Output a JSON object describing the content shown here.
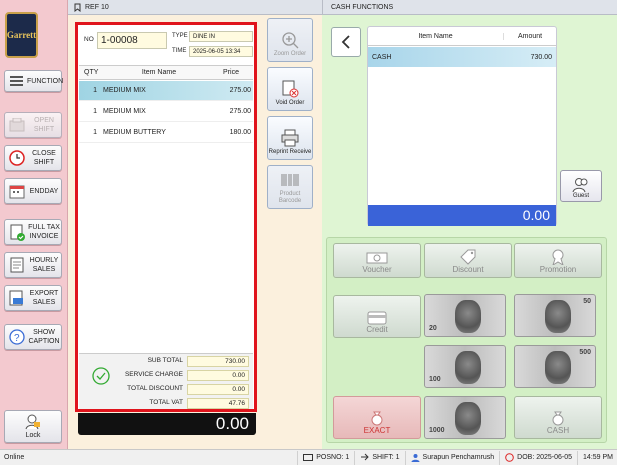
{
  "ref_bar": {
    "label": "REF 10"
  },
  "cash_bar": {
    "label": "CASH FUNCTIONS"
  },
  "logo": {
    "text": "Garrett"
  },
  "sidebar": {
    "function": "FUNCTION",
    "open_shift": "OPEN SHIFT",
    "close_shift": "CLOSE SHIFT",
    "endday": "ENDDAY",
    "full_tax_invoice": "FULL TAX INVOICE",
    "hourly_sales": "HOURLY SALES",
    "export_sales": "EXPORT SALES",
    "show_caption": "SHOW CAPTION",
    "lock": "Lock"
  },
  "order": {
    "no_label": "NO",
    "no_value": "1-00008",
    "type_label": "TYPE",
    "type_value": "DINE IN",
    "time_label": "TIME",
    "time_value": "2025-06-05 13:34",
    "columns": {
      "qty": "QTY",
      "item": "Item Name",
      "price": "Price"
    },
    "items": [
      {
        "qty": "1",
        "name": "MEDIUM MIX",
        "price": "275.00"
      },
      {
        "qty": "1",
        "name": "MEDIUM MIX",
        "price": "275.00"
      },
      {
        "qty": "1",
        "name": "MEDIUM BUTTERY",
        "price": "180.00"
      }
    ],
    "totals": {
      "sub_total_label": "SUB TOTAL",
      "sub_total": "730.00",
      "service_charge_label": "SERVICE CHARGE",
      "service_charge": "0.00",
      "total_discount_label": "TOTAL DISCOUNT",
      "total_discount": "0.00",
      "total_vat_label": "TOTAL VAT",
      "total_vat": "47.76"
    },
    "grand_total": "0.00"
  },
  "mid_buttons": {
    "zoom_order": "Zoom Order",
    "void_order": "Void Order",
    "reprint_receive": "Reprint Receive",
    "product_barcode": "Product Barcode"
  },
  "payment": {
    "columns": {
      "item": "Item Name",
      "amount": "Amount"
    },
    "rows": [
      {
        "name": "CASH",
        "amount": "730.00"
      }
    ],
    "total": "0.00"
  },
  "guest": "Guest",
  "pay_buttons": {
    "voucher": "Voucher",
    "discount": "Discount",
    "promotion": "Promotion",
    "credit": "Credit",
    "exact": "EXACT",
    "cash": "CASH"
  },
  "banknotes": {
    "b20": "20",
    "b50": "50",
    "b100": "100",
    "b500": "500",
    "b1000": "1000"
  },
  "status": {
    "online": "Online",
    "posno": "POSNO: 1",
    "shift": "SHIFT: 1",
    "user": "Surapun Penchamrush",
    "dob": "DOB: 2025-06-05",
    "time": "14:59 PM"
  },
  "colors": {
    "accent_red": "#e0141c",
    "total_blue": "#3a63d8"
  }
}
